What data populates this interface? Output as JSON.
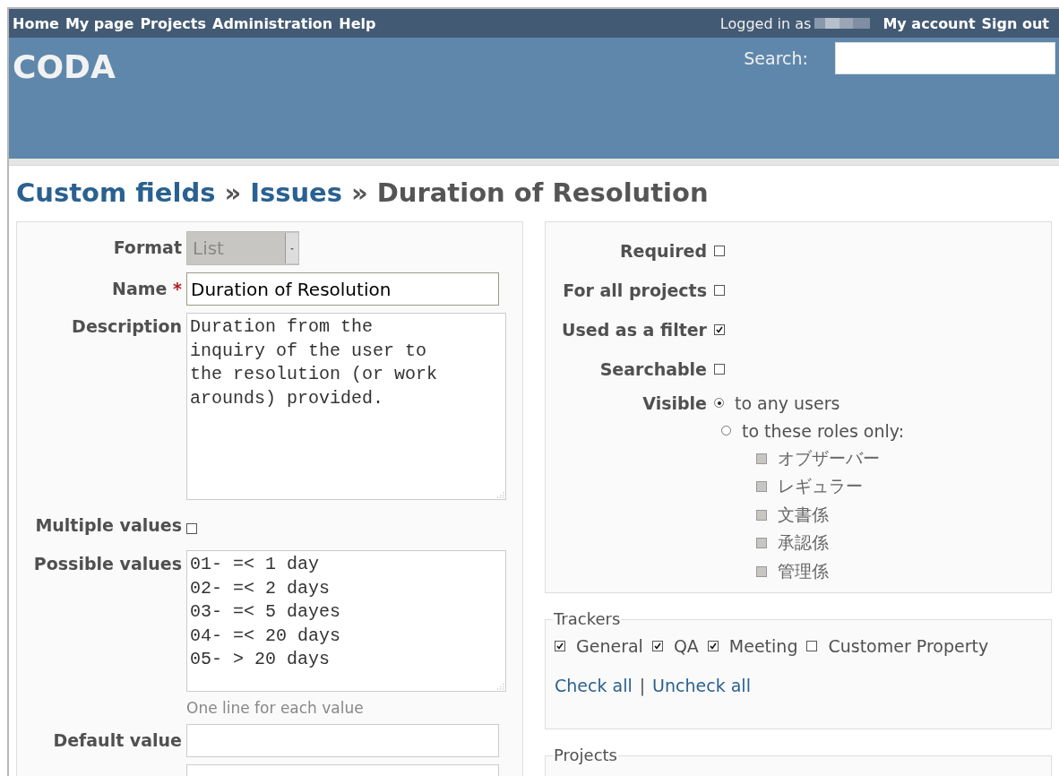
{
  "top_menu": [
    {
      "label": "Home"
    },
    {
      "label": "My page"
    },
    {
      "label": "Projects"
    },
    {
      "label": "Administration"
    },
    {
      "label": "Help"
    }
  ],
  "account": {
    "logged_in_as": "Logged in as",
    "links": [
      "My account",
      "Sign out"
    ]
  },
  "header": {
    "title": "CODA",
    "search_label": "Search:"
  },
  "breadcrumb": [
    "Custom fields",
    "Issues"
  ],
  "breadcrumb_separator": "»",
  "page_title": "Duration of Resolution",
  "left": {
    "format": {
      "label": "Format",
      "value": "List",
      "disabled": true
    },
    "name": {
      "label": "Name",
      "required_mark": "*",
      "value": "Duration of Resolution"
    },
    "description": {
      "label": "Description",
      "value": "Duration from the inquiry of the user to the resolution (or work arounds) provided."
    },
    "multiple_values": {
      "label": "Multiple values",
      "checked": false
    },
    "possible_values": {
      "label": "Possible values",
      "value": "01- =< 1 day\n02- =< 2 days\n03- =< 5 dayes\n04- =< 20 days\n05- > 20 days",
      "hint": "One line for each value"
    },
    "default_value": {
      "label": "Default value"
    }
  },
  "right": {
    "options": [
      {
        "label": "Required",
        "checked": false
      },
      {
        "label": "For all projects",
        "checked": false
      },
      {
        "label": "Used as a filter",
        "checked": true
      },
      {
        "label": "Searchable",
        "checked": false
      }
    ],
    "visible": {
      "label": "Visible",
      "choices": [
        {
          "label": "to any users",
          "selected": true
        },
        {
          "label": "to these roles only:",
          "selected": false
        }
      ],
      "roles": [
        {
          "label": "オブザーバー",
          "checked": false,
          "disabled": true
        },
        {
          "label": "レギュラー",
          "checked": false,
          "disabled": true
        },
        {
          "label": "文書係",
          "checked": false,
          "disabled": true
        },
        {
          "label": "承認係",
          "checked": false,
          "disabled": true
        },
        {
          "label": "管理係",
          "checked": false,
          "disabled": true
        }
      ]
    }
  },
  "trackers": {
    "legend": "Trackers",
    "items": [
      {
        "label": "General",
        "checked": true
      },
      {
        "label": "QA",
        "checked": true
      },
      {
        "label": "Meeting",
        "checked": true
      },
      {
        "label": "Customer Property",
        "checked": false
      }
    ],
    "check_all": "Check all",
    "separator": "|",
    "uncheck_all": "Uncheck all"
  },
  "projects": {
    "legend": "Projects"
  }
}
